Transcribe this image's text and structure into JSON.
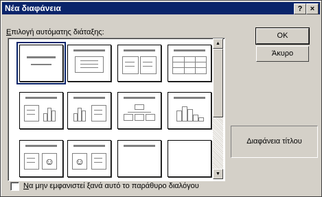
{
  "window": {
    "title": "Νέα διαφάνεια",
    "help_glyph": "?",
    "close_glyph": "×"
  },
  "layout_label_u": "Ε",
  "layout_label_rest": "πιλογή αυτόματης διάταξης:",
  "buttons": {
    "ok": "OK",
    "cancel": "Άκυρο"
  },
  "preview": {
    "name": "Διαφάνεια τίτλου"
  },
  "checkbox": {
    "label_u": "Ν",
    "label_rest": "α μην εμφανιστεί ξανά αυτό το παράθυρο διαλόγου",
    "checked": false
  },
  "scroll": {
    "up": "▲",
    "down": "▼"
  },
  "layouts": [
    "title-slide",
    "bulleted-list",
    "two-column-text",
    "table",
    "text-and-chart",
    "chart-and-text",
    "organization-chart",
    "chart",
    "text-and-clip-art",
    "clip-art-and-text",
    "title-only",
    "blank"
  ],
  "selected_layout": "title-slide"
}
